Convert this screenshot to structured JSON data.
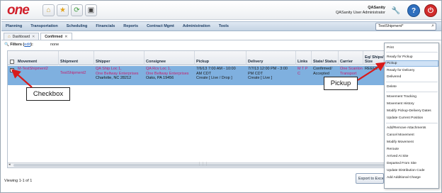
{
  "header": {
    "logo_text": "one",
    "user_name": "QASanity",
    "user_role": "QASanity User Administrator",
    "icons": [
      "home-icon",
      "star-icon",
      "recycle-icon",
      "screen-icon"
    ]
  },
  "nav": {
    "items": [
      "Planning",
      "Transportation",
      "Scheduling",
      "Financials",
      "Reports",
      "Contract Mgmt",
      "Administration",
      "Tools"
    ],
    "search_value": "TestShipment*"
  },
  "tabs": [
    {
      "label": "Dashboard"
    },
    {
      "label": "Confirmed"
    }
  ],
  "filter": {
    "label": "Filters (",
    "edit": "edit",
    "tail": "):",
    "value": "none"
  },
  "grid": {
    "columns": [
      "Movement",
      "Shipment",
      "Shipper",
      "Consignee",
      "Pickup",
      "Delivery",
      "Links",
      "State/ Status",
      "Carrier",
      "Eq/ Ships/ Size"
    ],
    "row": {
      "movement": "M-TestShipment2",
      "shipment": "TestShipment2",
      "shipper_1": "QA Ship Loc 1,",
      "shipper_2": "One Beltway Enterprises",
      "shipper_3": "Charlotte, NC 28212",
      "consignee_1": "QA Rcv Loc 1,",
      "consignee_2": "One Beltway Enterprises",
      "consignee_3": "Oaks, PA 19456",
      "pickup_1": "7/6/13 7:00 AM - 10:00",
      "pickup_2": "AM CDT",
      "pickup_3": "Create [ Live / Drop ]",
      "delivery_1": "7/7/13 12:00 PM - 3:00",
      "delivery_2": "PM CDT",
      "delivery_3": "Create [ Live ]",
      "links_1": "M T P",
      "links_2": "C",
      "status_1": "Confirmed/",
      "status_2": "Accepted",
      "carrier_1": "One Scanlon",
      "carrier_2": "Transport",
      "eq_1": "REEFE..."
    },
    "footer": "Viewing 1-1 of 1",
    "export_label": "Export to Excel"
  },
  "menu": {
    "items": [
      {
        "label": "Print"
      },
      {
        "label": "Ready for Pickup"
      },
      {
        "label": "Pickup",
        "highlighted": true
      },
      {
        "label": "Ready for Delivery"
      },
      {
        "label": "Delivered"
      },
      {
        "label": "Delete"
      },
      {
        "label": "Movement Tracking"
      },
      {
        "label": "Movement History"
      },
      {
        "label": "Modify Pickup-Delivery Dates"
      },
      {
        "label": "Update Current Position"
      },
      {
        "label": "Add/Remove Attachments"
      },
      {
        "label": "Cancel Movement"
      },
      {
        "label": "Modify Movement"
      },
      {
        "label": "Reroute"
      },
      {
        "label": "Arrived At Site"
      },
      {
        "label": "Departed From Site"
      },
      {
        "label": "Update Distribution Code"
      },
      {
        "label": "Add Additional Charge"
      }
    ]
  },
  "callouts": {
    "checkbox": "Checkbox",
    "pickup": "Pickup"
  },
  "colors": {
    "brand_red": "#d11f2a",
    "row_selected": "#7fb0df",
    "callout_arrow": "#d81b1b"
  }
}
